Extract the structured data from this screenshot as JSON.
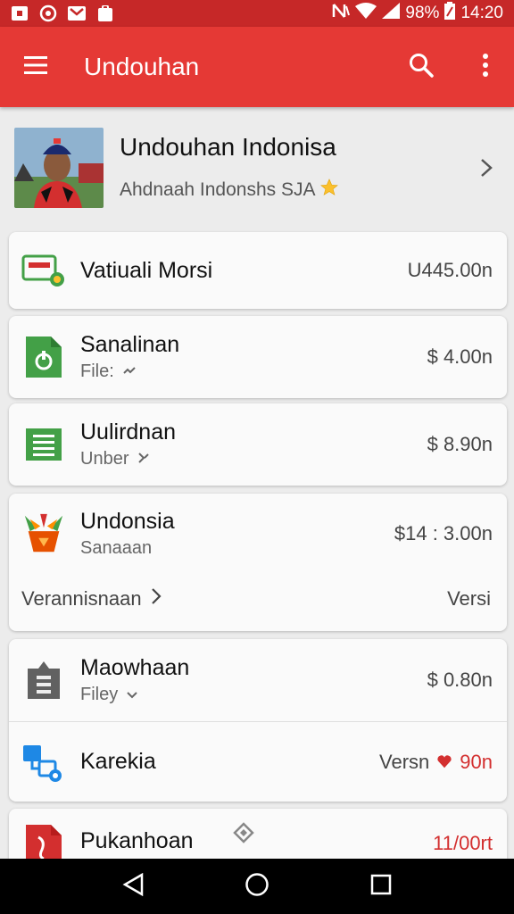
{
  "status_bar": {
    "battery_text": "98%",
    "time": "14:20"
  },
  "app_bar": {
    "title": "Undouhan"
  },
  "profile": {
    "name": "Undouhan Indonisa",
    "subtitle": "Ahdnaah Indonshs SJA"
  },
  "items": [
    {
      "title": "Vatiuali Morsi",
      "sub": "",
      "value": "U445.00n"
    },
    {
      "title": "Sanalinan",
      "sub": "File:",
      "value": "$ 4.00n"
    },
    {
      "title": "Uulirdnan",
      "sub": "Unber",
      "value": "$ 8.90n"
    },
    {
      "title": "Undonsia",
      "sub": "Sanaaan",
      "value": "$14 : 3.00n",
      "footer_left": "Verannisnaan",
      "footer_right": "Versi"
    },
    {
      "title": "Maowhaan",
      "sub": "Filey",
      "value": "$ 0.80n"
    },
    {
      "title": "Karekia",
      "sub": "",
      "value_prefix": "Versn",
      "value": "90n"
    },
    {
      "title": "Pukanhoan",
      "sub": "",
      "value": "11/00rt"
    }
  ],
  "colors": {
    "app_bar": "#e53935",
    "status_bar": "#c62828",
    "accent_red": "#d32f2f",
    "green": "#43a047",
    "blue": "#1e88e5"
  }
}
